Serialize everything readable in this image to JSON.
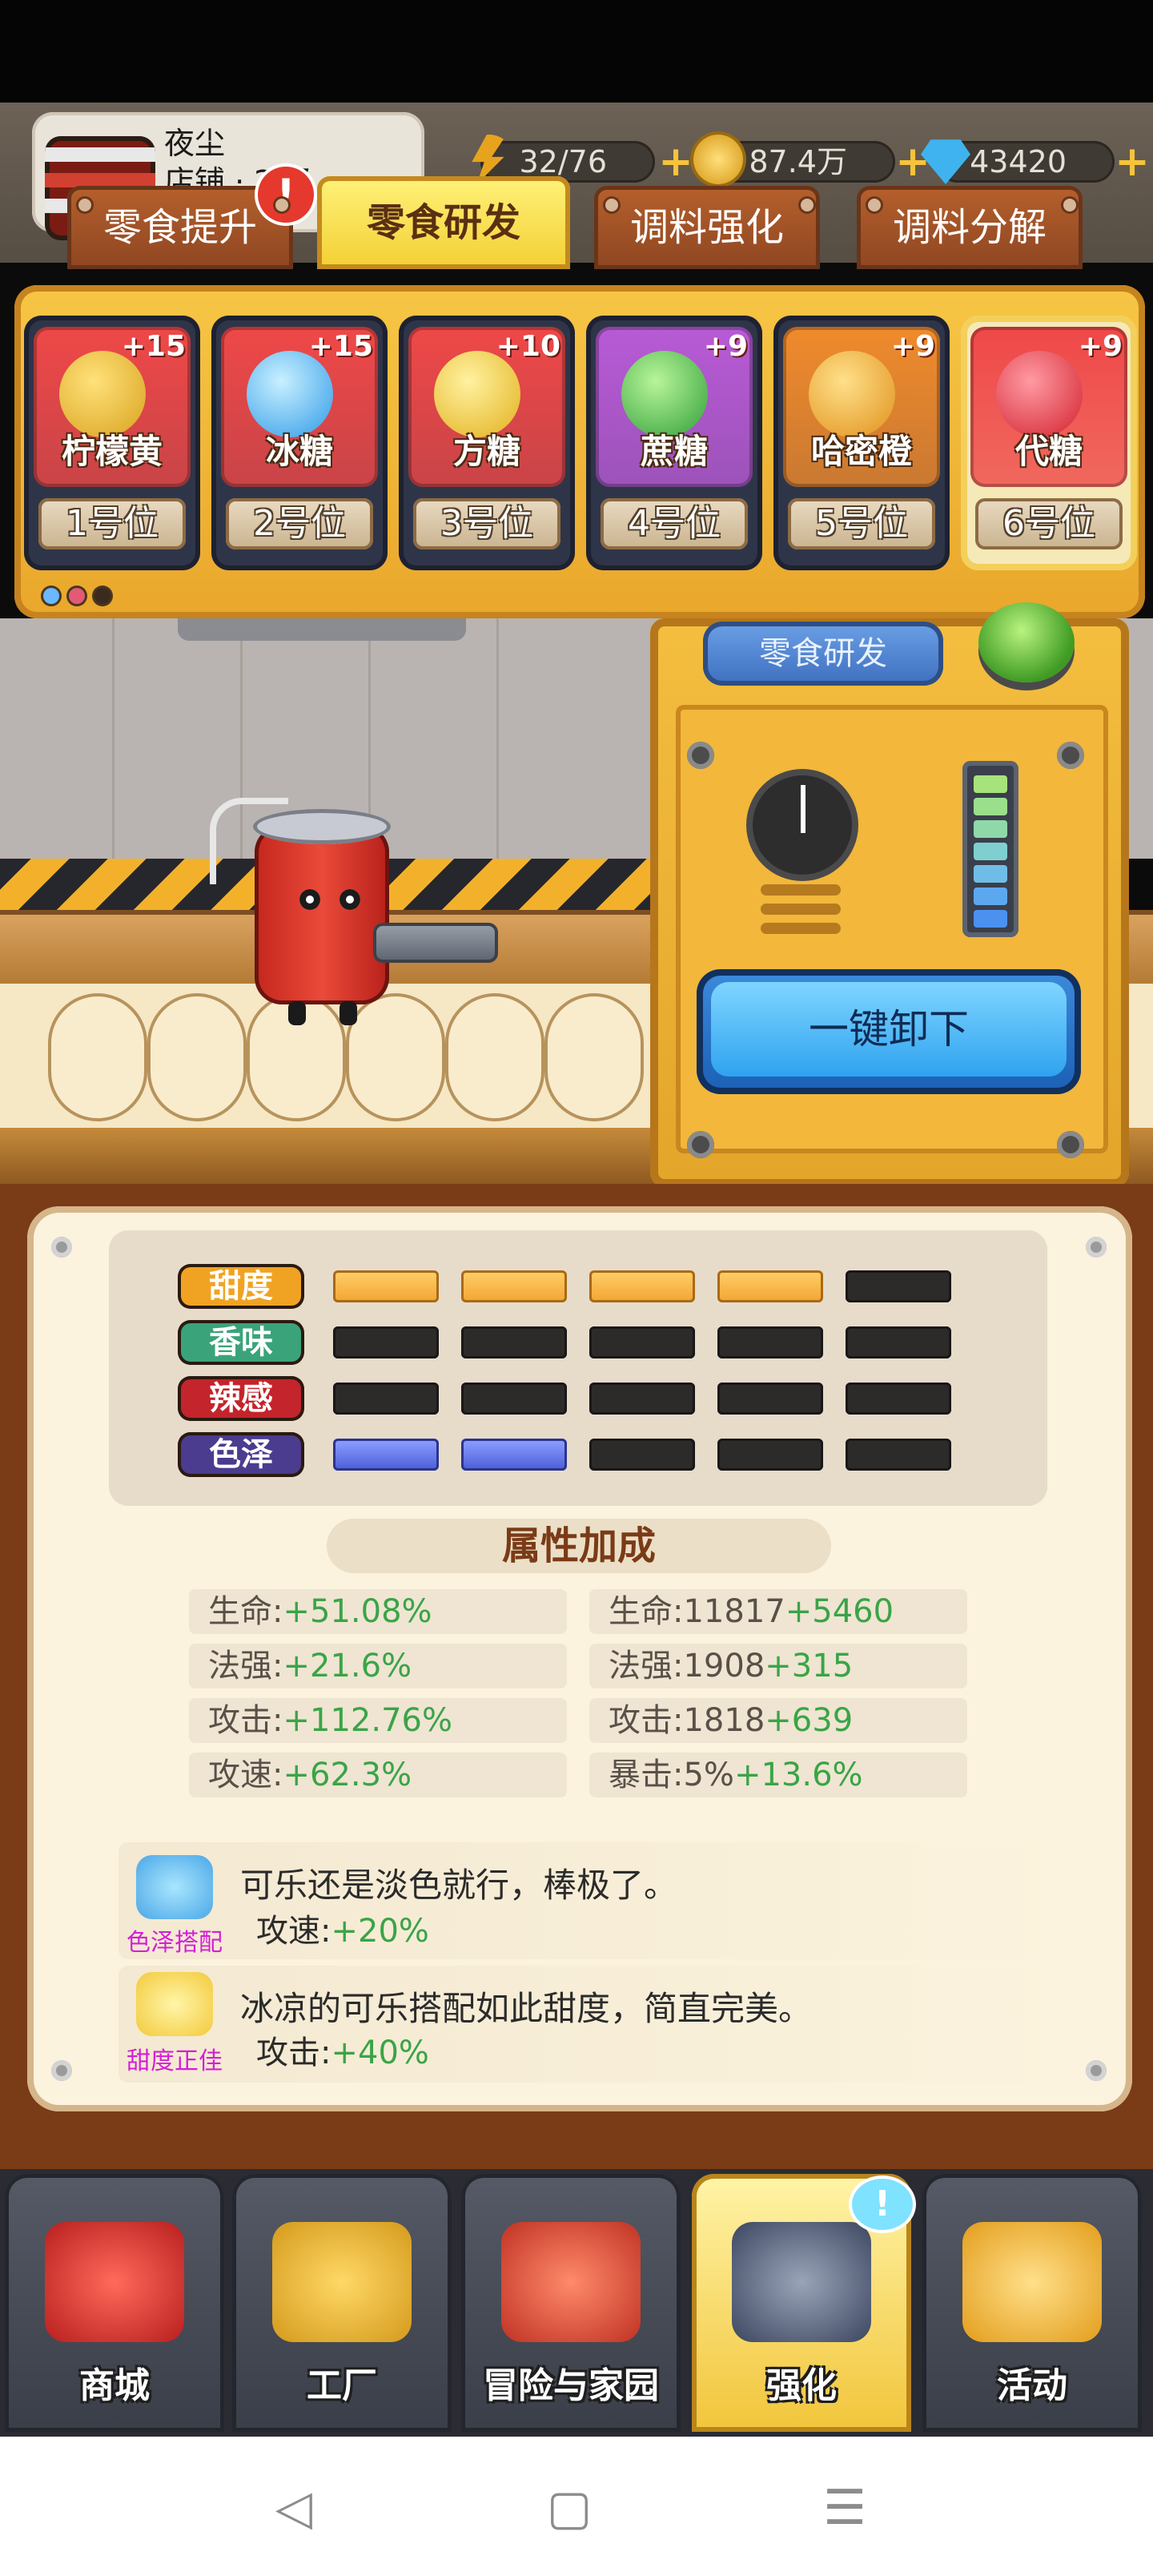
{
  "player": {
    "name": "夜尘",
    "level_text": "店铺 · 2 级"
  },
  "resources": {
    "energy": "32/76",
    "coins": "87.4万",
    "gems": "43420"
  },
  "tabs": [
    {
      "label": "零食提升",
      "alert": "!"
    },
    {
      "label": "零食研发"
    },
    {
      "label": "调料强化"
    },
    {
      "label": "调料分解"
    }
  ],
  "slots": [
    {
      "name": "柠檬黄",
      "plus": "+15",
      "position": "1号位",
      "color": "#ef4848"
    },
    {
      "name": "冰糖",
      "plus": "+15",
      "position": "2号位",
      "color": "#ef4848"
    },
    {
      "name": "方糖",
      "plus": "+10",
      "position": "3号位",
      "color": "#ef4848"
    },
    {
      "name": "蔗糖",
      "plus": "+9",
      "position": "4号位",
      "color": "#b85ad6"
    },
    {
      "name": "哈密橙",
      "plus": "+9",
      "position": "5号位",
      "color": "#f08a2c"
    },
    {
      "name": "代糖",
      "plus": "+9",
      "position": "6号位",
      "color": "#ef4848"
    }
  ],
  "machine": {
    "title": "零食研发",
    "unload_button": "一键卸下"
  },
  "stats": [
    {
      "label": "甜度",
      "color": "#f0a323",
      "filled": 4,
      "fill": "orange"
    },
    {
      "label": "香味",
      "color": "#3aa37a",
      "filled": 0,
      "fill": "none"
    },
    {
      "label": "辣感",
      "color": "#c4242c",
      "filled": 0,
      "fill": "none"
    },
    {
      "label": "色泽",
      "color": "#4b3c8f",
      "filled": 2,
      "fill": "blue"
    }
  ],
  "bonus": {
    "title": "属性加成",
    "left": [
      {
        "k": "生命:",
        "v": "+51.08%"
      },
      {
        "k": "法强:",
        "v": "+21.6%"
      },
      {
        "k": "攻击:",
        "v": "+112.76%"
      },
      {
        "k": "攻速:",
        "v": "+62.3%"
      }
    ],
    "right": [
      {
        "k": "生命:11817",
        "v": "+5460"
      },
      {
        "k": "法强:1908",
        "v": "+315"
      },
      {
        "k": "攻击:1818",
        "v": "+639"
      },
      {
        "k": "暴击:5%",
        "v": "+13.6%"
      }
    ]
  },
  "combos": [
    {
      "tag": "色泽搭配",
      "text": "可乐还是淡色就行，棒极了。",
      "sub_key": "攻速:",
      "sub_val": "+20%"
    },
    {
      "tag": "甜度正佳",
      "text": "冰凉的可乐搭配如此甜度，简直完美。",
      "sub_key": "攻击:",
      "sub_val": "+40%"
    }
  ],
  "nav": [
    {
      "label": "商城"
    },
    {
      "label": "工厂"
    },
    {
      "label": "冒险与家园"
    },
    {
      "label": "强化",
      "badge": "!"
    },
    {
      "label": "活动"
    }
  ],
  "sys_nav": {
    "back": "◁",
    "home": "▢",
    "menu": "☰"
  }
}
